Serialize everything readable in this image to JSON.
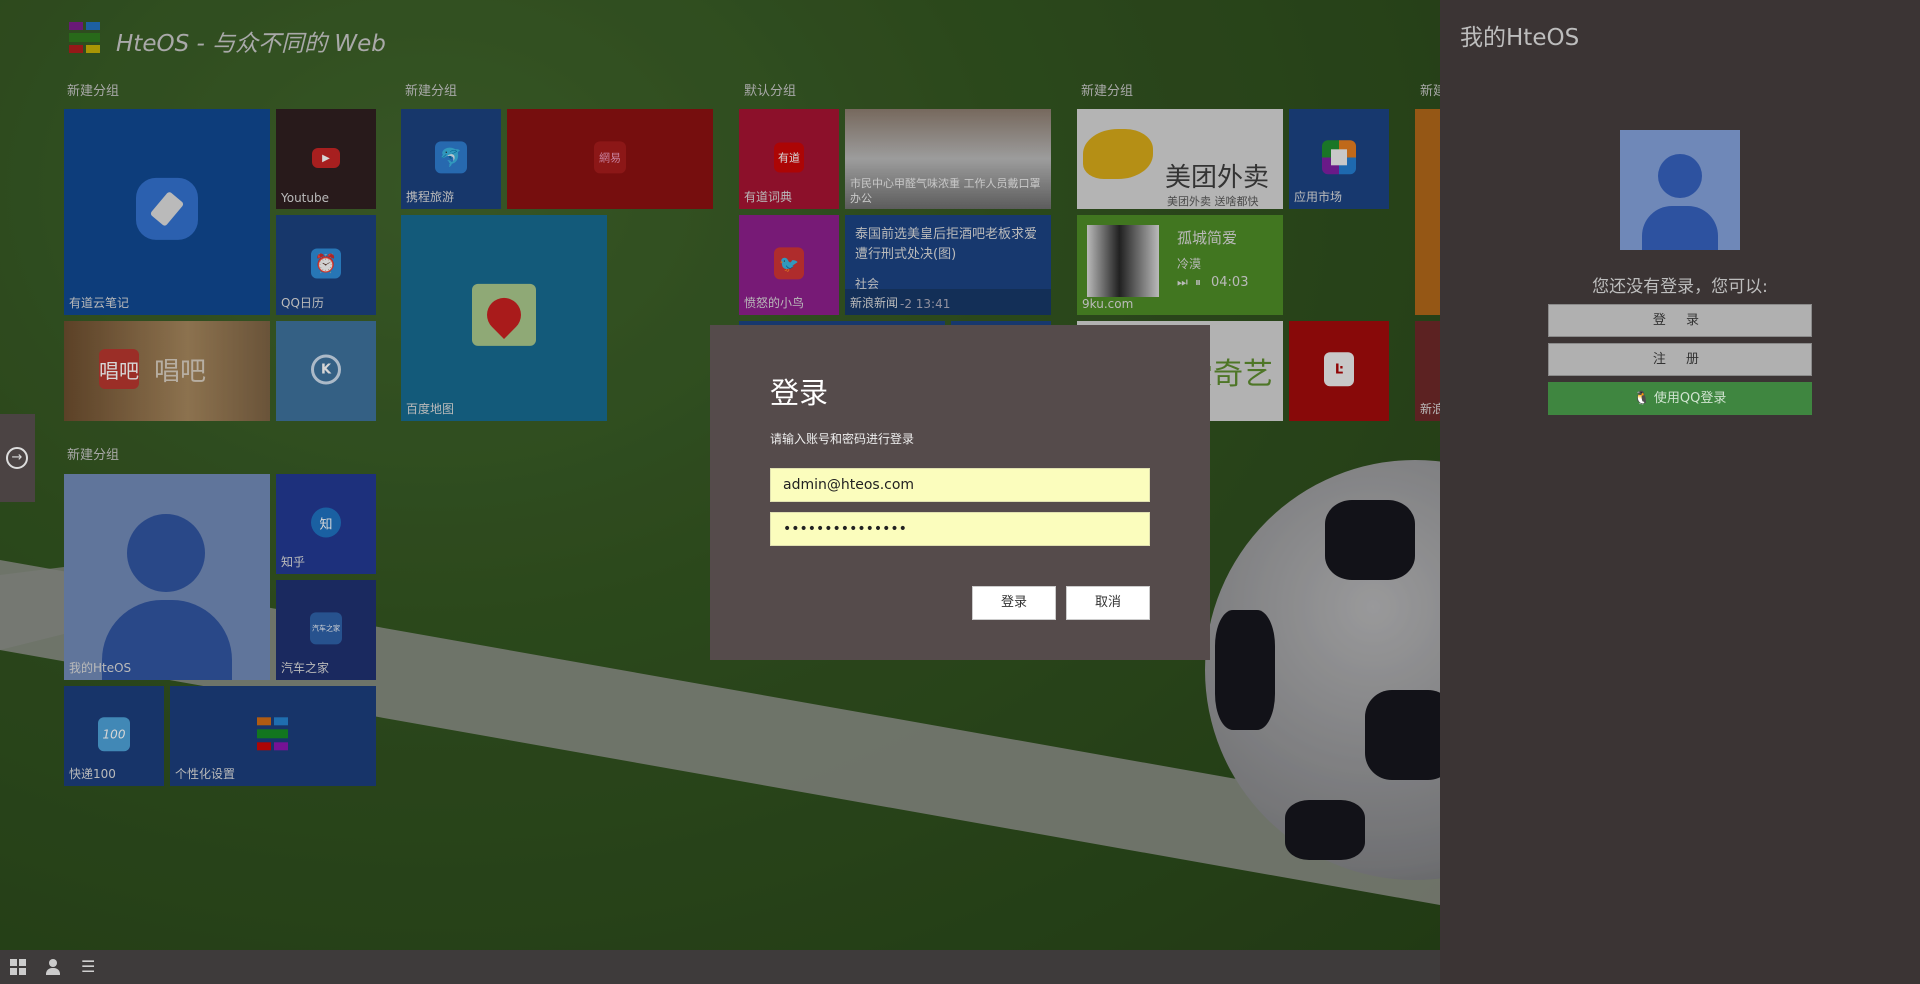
{
  "header": {
    "title": "HteOS - 与众不同的 Web"
  },
  "groups": [
    {
      "name": "新建分组",
      "tiles": [
        "有道云笔记",
        "Youtube",
        "QQ日历",
        "唱吧",
        ""
      ]
    },
    {
      "name": "新建分组",
      "tiles": [
        "携程旅游",
        "百度地图"
      ],
      "netease_icon": "網易"
    },
    {
      "name": "默认分组",
      "tiles": [
        "有道词典",
        "市民中心甲醛气味浓重 工作人员戴口罩办公",
        "愤怒的小鸟"
      ],
      "news": {
        "headline": "泰国前选美皇后拒酒吧老板求爱 遭行刑式处决(图)",
        "category": "社会",
        "source": "新浪新闻",
        "time": "-2 13:41"
      },
      "youdao_icon": "有道"
    },
    {
      "name": "新建分组",
      "tiles": [
        "应用市场",
        "爱奇艺"
      ],
      "meituan": {
        "brand": "美团外卖",
        "slogan": "美团外卖  送啥都快"
      },
      "music": {
        "song": "孤城简爱",
        "artist": "冷漠",
        "time": "04:03",
        "site": "9ku.com"
      }
    },
    {
      "name": "新建分组",
      "tiles": [
        "新浪"
      ]
    },
    {
      "name": "新建分组",
      "tiles": [
        "我的HteOS",
        "知乎",
        "汽车之家",
        "快递100",
        "个性化设置"
      ],
      "zhihu_icon": "知"
    }
  ],
  "dialog": {
    "title": "登录",
    "subtitle": "请输入账号和密码进行登录",
    "username": "admin@hteos.com",
    "password": "•••••••••••••••",
    "login": "登录",
    "cancel": "取消"
  },
  "panel": {
    "title": "我的HteOS",
    "prompt": "您还没有登录，您可以:",
    "login": "登 录",
    "register": "注 册",
    "qq_login": "使用QQ登录"
  },
  "taskbar": {
    "icons": [
      "start-grid-icon",
      "user-icon",
      "list-icon"
    ]
  }
}
